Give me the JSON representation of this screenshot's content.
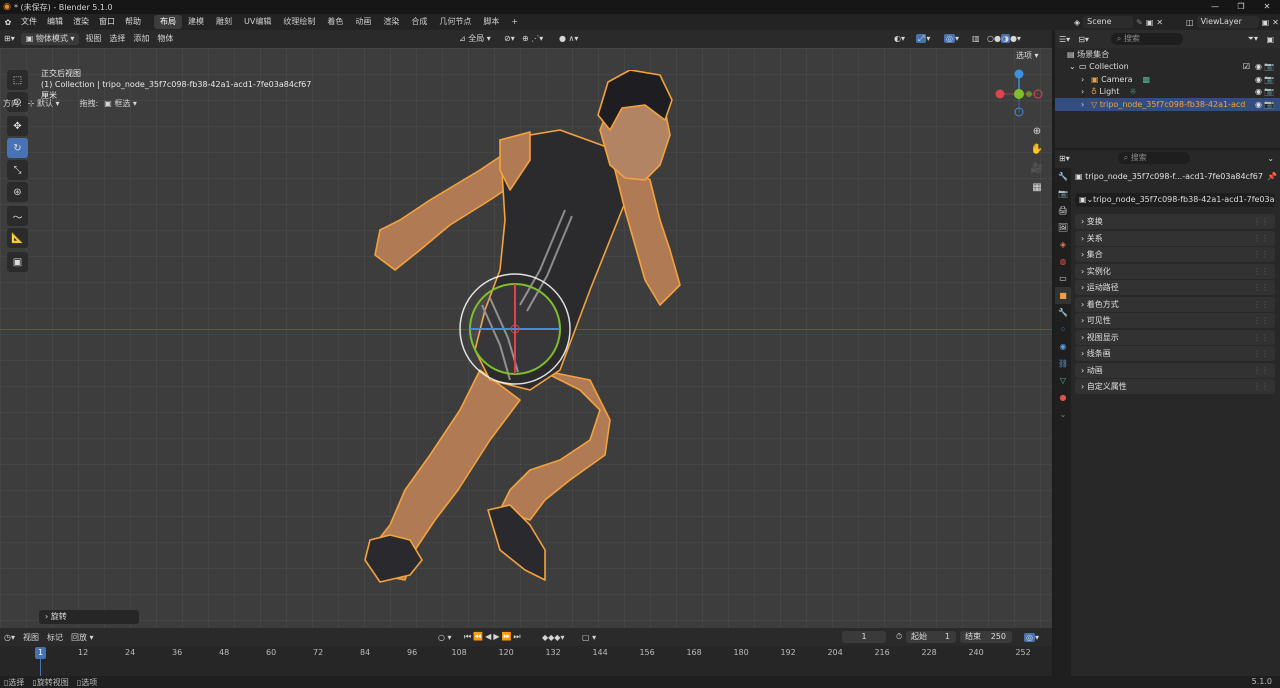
{
  "window": {
    "title": "* (未保存) - Blender 5.1.0",
    "controls": [
      "—",
      "❐",
      "✕"
    ]
  },
  "menu": [
    "文件",
    "编辑",
    "渲染",
    "窗口",
    "帮助"
  ],
  "workspaces": [
    "布局",
    "建模",
    "雕刻",
    "UV编辑",
    "纹理绘制",
    "着色",
    "动画",
    "渲染",
    "合成",
    "几何节点",
    "脚本"
  ],
  "active_workspace": "布局",
  "scene": {
    "name": "Scene",
    "view_layer": "ViewLayer"
  },
  "viewport_header": {
    "mode": "物体模式",
    "menus": [
      "视图",
      "选择",
      "添加",
      "物体"
    ],
    "transform_orientation": "全局"
  },
  "viewport_header2": {
    "orientation_label": "方向:",
    "orientation_value": "默认",
    "drag_label": "拖拽:",
    "drag_value": "框选",
    "options": "选项"
  },
  "overlay": {
    "view_name": "正交后视图",
    "collection_info": "(1) Collection | tripo_node_35f7c098-fb38-42a1-acd1-7fe03a84cf67",
    "units": "厘米"
  },
  "last_operator": "旋转",
  "timeline": {
    "menus": [
      "视图",
      "标记",
      "回放"
    ],
    "current_frame": "1",
    "start_label": "起始",
    "start": "1",
    "end_label": "结束",
    "end": "250",
    "ruler": [
      "12",
      "24",
      "36",
      "48",
      "60",
      "72",
      "84",
      "96",
      "108",
      "120",
      "132",
      "144",
      "156",
      "168",
      "180",
      "192",
      "204",
      "216",
      "228",
      "240",
      "252"
    ],
    "cursor": "1"
  },
  "statusbar": {
    "items": [
      "选择",
      "旋转视图",
      "选项"
    ],
    "version": "5.1.0"
  },
  "outliner": {
    "search_placeholder": "搜索",
    "root": "场景集合",
    "items": [
      {
        "label": "Collection"
      },
      {
        "label": "Camera"
      },
      {
        "label": "Light"
      },
      {
        "label": "tripo_node_35f7c098-fb38-42a1-acd"
      }
    ]
  },
  "properties": {
    "search_placeholder": "搜索",
    "object_name": "tripo_node_35f7c098-f...-acd1-7fe03a84cf67",
    "data_name": "tripo_node_35f7c098-fb38-42a1-acd1-7fe03a...",
    "panels": [
      "变换",
      "关系",
      "集合",
      "实例化",
      "运动路径",
      "着色方式",
      "可见性",
      "视图显示",
      "线条画",
      "动画",
      "自定义属性"
    ]
  },
  "colors": {
    "accent": "#4772b3",
    "selection": "#f3a23e",
    "x_axis": "#e0434f",
    "y_axis": "#7fbf2a",
    "z_axis": "#3d8fe0"
  }
}
